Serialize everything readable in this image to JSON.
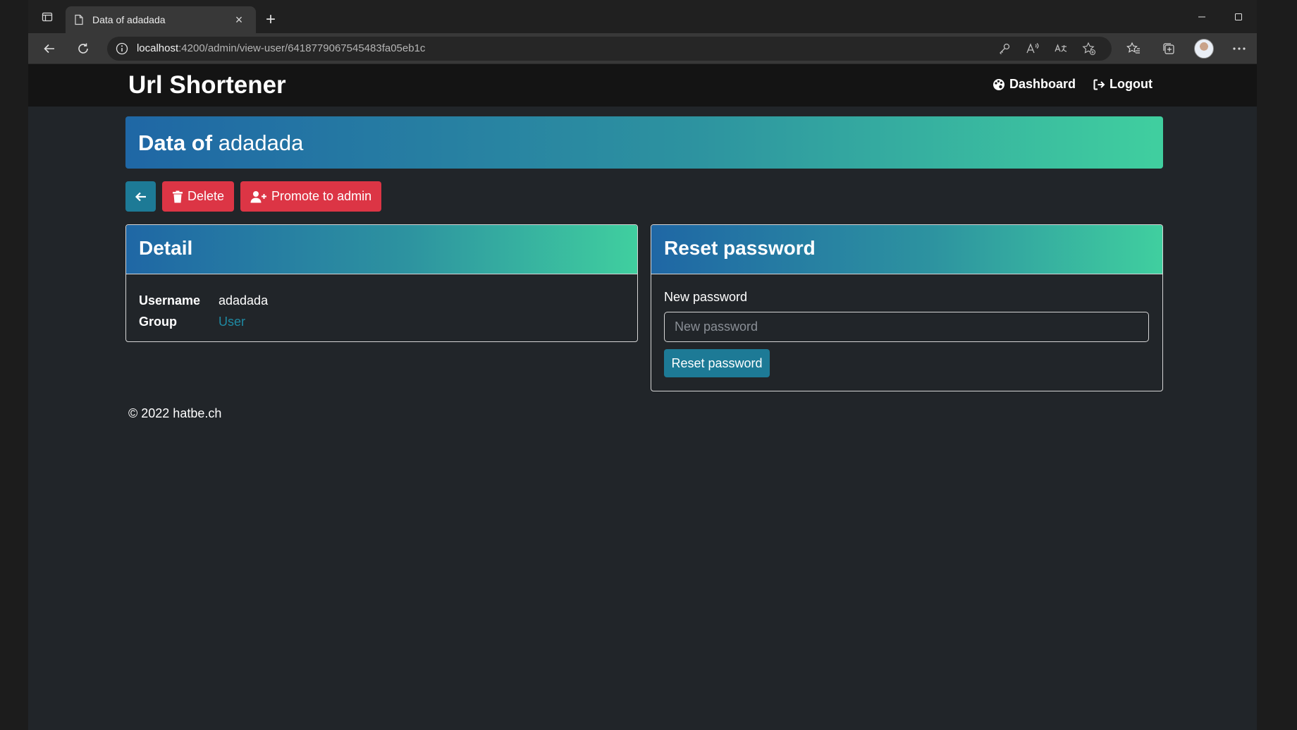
{
  "browser": {
    "tab_title": "Data of adadada",
    "tab_close": "×",
    "new_tab": "+",
    "url_host": "localhost",
    "url_rest": ":4200/admin/view-user/6418779067545483fa05eb1c"
  },
  "navbar": {
    "brand": "Url Shortener",
    "dashboard_label": "Dashboard",
    "logout_label": "Logout"
  },
  "hero": {
    "prefix": "Data of",
    "username": "adadada"
  },
  "actions": {
    "delete_label": "Delete",
    "promote_label": "Promote to admin"
  },
  "detail": {
    "title": "Detail",
    "rows": [
      {
        "term": "Username",
        "value": "adadada"
      },
      {
        "term": "Group",
        "value": "User"
      }
    ]
  },
  "reset": {
    "title": "Reset password",
    "field_label": "New password",
    "placeholder": "New password",
    "button_label": "Reset password"
  },
  "footer": {
    "text": "© 2022 hatbe.ch"
  },
  "colors": {
    "page_bg": "#212529",
    "navbar_bg": "#141414",
    "primary": "#1d7a96",
    "danger": "#dc3545",
    "gradient_start": "#1f67a5",
    "gradient_end": "#40cf9f",
    "link": "#1f8aa3"
  },
  "icons": {
    "sidebar_toggle": "sidebar-icon",
    "tab_page": "page-icon",
    "back": "arrow-left-icon",
    "reload": "reload-icon",
    "site_info": "info-icon",
    "key": "key-icon",
    "read_aloud": "read-aloud-icon",
    "translate": "translate-icon",
    "add_favorite": "star-plus-icon",
    "favorites": "favorites-icon",
    "collections": "collections-icon",
    "menu": "more-icon",
    "dashboard": "palette-icon",
    "logout": "logout-icon",
    "delete": "trash-icon",
    "promote": "user-plus-icon"
  }
}
